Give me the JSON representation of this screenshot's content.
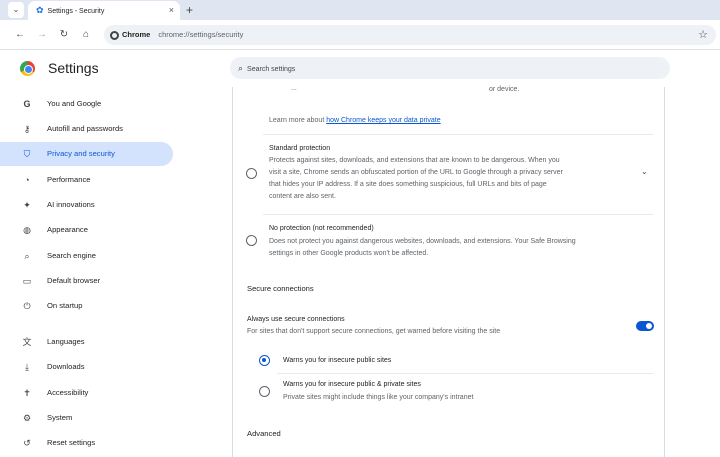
{
  "browser": {
    "tab_title": "Settings - Security",
    "url_chip": "Chrome",
    "url": "chrome://settings/security"
  },
  "header": {
    "title": "Settings",
    "search_placeholder": "Search settings"
  },
  "sidebar": {
    "items": [
      {
        "label": "You and Google",
        "icon": "google-g"
      },
      {
        "label": "Autofill and passwords",
        "icon": "key"
      },
      {
        "label": "Privacy and security",
        "icon": "shield",
        "active": true
      },
      {
        "label": "Performance",
        "icon": "speedometer"
      },
      {
        "label": "AI innovations",
        "icon": "sparkle"
      },
      {
        "label": "Appearance",
        "icon": "palette"
      },
      {
        "label": "Search engine",
        "icon": "search"
      },
      {
        "label": "Default browser",
        "icon": "browser-window"
      },
      {
        "label": "On startup",
        "icon": "power"
      },
      {
        "label": "Languages",
        "icon": "translate"
      },
      {
        "label": "Downloads",
        "icon": "download"
      },
      {
        "label": "Accessibility",
        "icon": "accessibility"
      },
      {
        "label": "System",
        "icon": "wrench"
      },
      {
        "label": "Reset settings",
        "icon": "reset"
      }
    ]
  },
  "main": {
    "clipped_top_left": "...",
    "clipped_top_right": "or device.",
    "learn_more_prefix": "Learn more about ",
    "learn_more_link": "how Chrome keeps your data private",
    "standard": {
      "title": "Standard protection",
      "desc1": "Protects against sites, downloads, and extensions that are known to be dangerous. When you",
      "desc2": "visit a site, Chrome sends an obfuscated portion of the URL to Google through a privacy server",
      "desc3": "that hides your IP address. If a site does something suspicious, full URLs and bits of page",
      "desc4": "content are also sent."
    },
    "none": {
      "title": "No protection (not recommended)",
      "desc1": "Does not protect you against dangerous websites, downloads, and extensions. Your Safe Browsing",
      "desc2": "settings in other Google products won't be affected."
    },
    "secure_connections": {
      "section": "Secure connections",
      "always_title": "Always use secure connections",
      "always_desc": "For sites that don't support secure connections, get warned before visiting the site",
      "toggle_on": true,
      "opt_public_label": "Warns you for insecure public sites",
      "opt_private_label": "Warns you for insecure public & private sites",
      "opt_private_desc": "Private sites might include things like your company's intranet"
    },
    "advanced": "Advanced"
  }
}
